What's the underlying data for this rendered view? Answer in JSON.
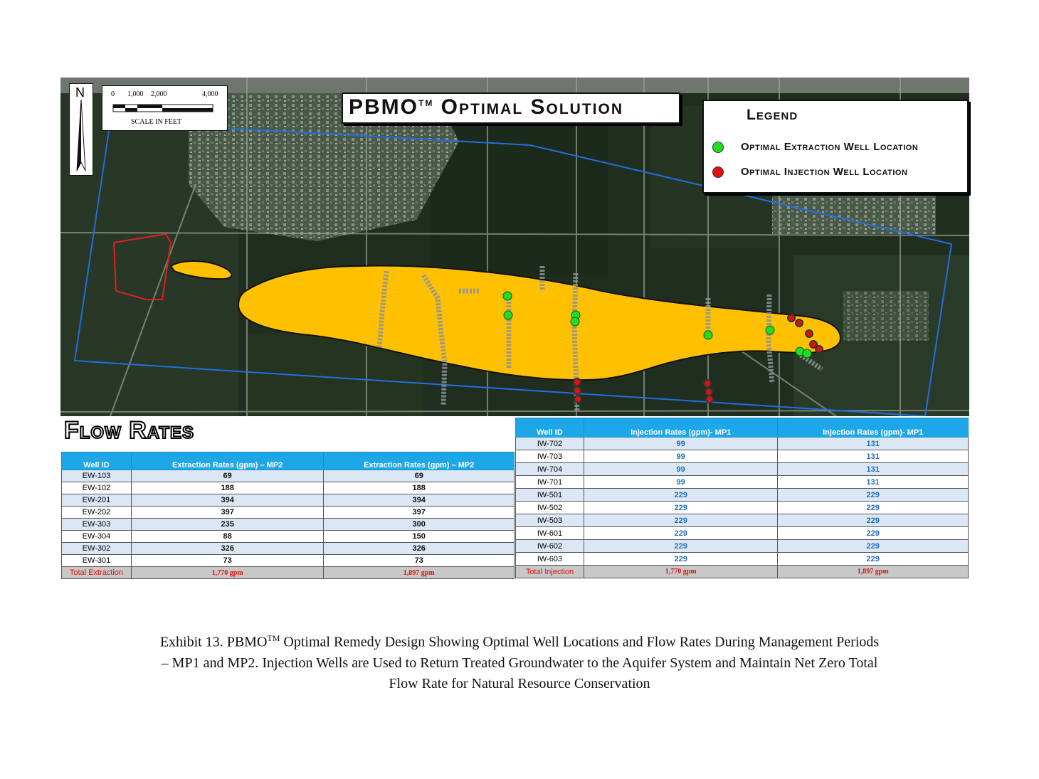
{
  "title": {
    "main": "PBMO",
    "tm": "TM",
    "rest": "Optimal Solution"
  },
  "north": "N",
  "scale": {
    "ticks": [
      "0",
      "1,000",
      "2,000",
      "4,000"
    ],
    "label": "SCALE IN FEET"
  },
  "legend": {
    "title": "Legend",
    "items": [
      {
        "label": "Optimal Extraction Well Location",
        "color": "#22dd22"
      },
      {
        "label": "Optimal Injection Well Location",
        "color": "#dd1111"
      }
    ]
  },
  "flow_title": "Flow Rates",
  "extraction_table": {
    "headers": [
      "Well ID",
      "Extraction  Rates (gpm) – MP2",
      "Extraction  Rates (gpm) – MP2"
    ],
    "rows": [
      [
        "EW-103",
        "69",
        "69"
      ],
      [
        "EW-102",
        "188",
        "188"
      ],
      [
        "EW-201",
        "394",
        "394"
      ],
      [
        "EW-202",
        "397",
        "397"
      ],
      [
        "EW-303",
        "235",
        "300"
      ],
      [
        "EW-304",
        "88",
        "150"
      ],
      [
        "EW-302",
        "326",
        "326"
      ],
      [
        "EW-301",
        "73",
        "73"
      ]
    ],
    "total": [
      "Total Extraction",
      "1,770 gpm",
      "1,897 gpm"
    ]
  },
  "injection_table": {
    "headers": [
      "Well ID",
      "Injection  Rates (gpm)- MP1",
      "Injection  Rates (gpm)- MP1"
    ],
    "rows": [
      [
        "IW-702",
        "99",
        "131"
      ],
      [
        "IW-703",
        "99",
        "131"
      ],
      [
        "IW-704",
        "99",
        "131"
      ],
      [
        "IW-701",
        "99",
        "131"
      ],
      [
        "IW-501",
        "229",
        "229"
      ],
      [
        "IW-502",
        "229",
        "229"
      ],
      [
        "IW-503",
        "229",
        "229"
      ],
      [
        "IW-601",
        "229",
        "229"
      ],
      [
        "IW-602",
        "229",
        "229"
      ],
      [
        "IW-603",
        "229",
        "229"
      ]
    ],
    "total": [
      "Total Injection",
      "1,770 gpm",
      "1,897 gpm"
    ]
  },
  "caption": {
    "pre": "Exhibit 13. PBMO",
    "tm": "TM",
    "line1": " Optimal Remedy Design Showing Optimal Well Locations and Flow Rates During Management Periods",
    "line2": "– MP1 and MP2. Injection Wells are Used to Return Treated Groundwater to the Aquifer System and Maintain Net Zero Total",
    "line3": "Flow Rate for Natural Resource Conservation"
  },
  "colors": {
    "plume": "#ffc000",
    "boundary": "#1f6fe0",
    "site": "#e02020",
    "header": "#1ea7e8"
  }
}
